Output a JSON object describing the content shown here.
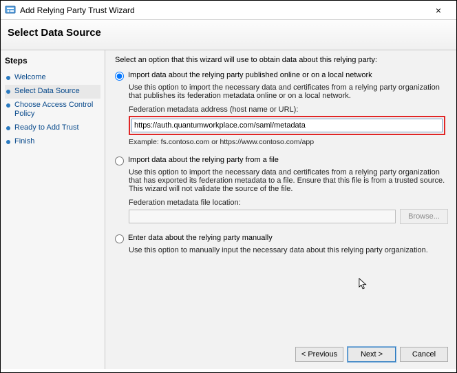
{
  "window": {
    "title": "Add Relying Party Trust Wizard"
  },
  "header": {
    "title": "Select Data Source"
  },
  "sidebar": {
    "title": "Steps",
    "items": [
      {
        "label": "Welcome"
      },
      {
        "label": "Select Data Source"
      },
      {
        "label": "Choose Access Control Policy"
      },
      {
        "label": "Ready to Add Trust"
      },
      {
        "label": "Finish"
      }
    ]
  },
  "main": {
    "intro": "Select an option that this wizard will use to obtain data about this relying party:",
    "option1": {
      "label": "Import data about the relying party published online or on a local network",
      "desc": "Use this option to import the necessary data and certificates from a relying party organization that publishes its federation metadata online or on a local network.",
      "field_label": "Federation metadata address (host name or URL):",
      "value": "https://auth.quantumworkplace.com/saml/metadata",
      "example": "Example: fs.contoso.com or https://www.contoso.com/app"
    },
    "option2": {
      "label": "Import data about the relying party from a file",
      "desc": "Use this option to import the necessary data and certificates from a relying party organization that has exported its federation metadata to a file. Ensure that this file is from a trusted source.  This wizard will not validate the source of the file.",
      "field_label": "Federation metadata file location:",
      "browse": "Browse..."
    },
    "option3": {
      "label": "Enter data about the relying party manually",
      "desc": "Use this option to manually input the necessary data about this relying party organization."
    }
  },
  "footer": {
    "previous": "< Previous",
    "next": "Next >",
    "cancel": "Cancel"
  }
}
